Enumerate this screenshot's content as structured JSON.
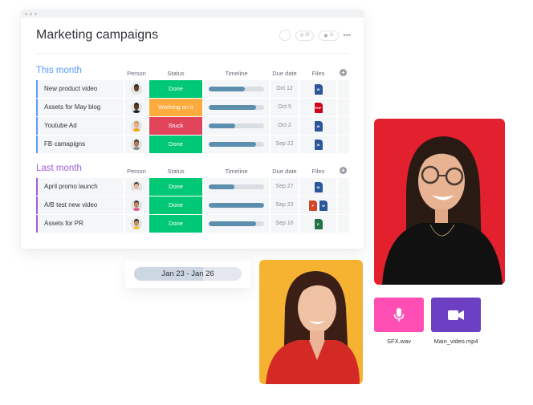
{
  "board": {
    "title": "Marketing campaigns",
    "header_tools": {
      "activity_count": "/0",
      "views_count": "/1",
      "more": "•••"
    }
  },
  "columns": {
    "person": "Person",
    "status": "Status",
    "timeline": "Timeline",
    "due_date": "Due date",
    "files": "Files",
    "add": "+"
  },
  "groups": [
    {
      "title": "This month",
      "accent_color": "#579bfc",
      "title_color": "#579bfc",
      "rows": [
        {
          "name": "New product video",
          "status": "Done",
          "status_color": "#00c875",
          "timeline_progress": 0.65,
          "due": "Oct 12",
          "files": [
            {
              "type": "W",
              "color": "#2b579a"
            }
          ],
          "avatar": {
            "skin": "#6b4226",
            "hair": "#1b1b1b",
            "shirt": "#e9e9e9"
          }
        },
        {
          "name": "Assets for May blog",
          "status": "Working on it",
          "status_color": "#fdab3d",
          "timeline_progress": 0.85,
          "due": "Oct 5",
          "files": [
            {
              "type": "PDF",
              "color": "#d0021b"
            }
          ],
          "avatar": {
            "skin": "#5b3a23",
            "hair": "#1b1b1b",
            "shirt": "#222222"
          }
        },
        {
          "name": "Youtube Ad",
          "status": "Stuck",
          "status_color": "#e2445c",
          "timeline_progress": 0.48,
          "due": "Oct 2",
          "files": [
            {
              "type": "W",
              "color": "#2b579a"
            }
          ],
          "avatar": {
            "skin": "#e8b48f",
            "hair": "#c98a3c",
            "shirt": "#f0a500"
          }
        },
        {
          "name": "FB camapigns",
          "status": "Done",
          "status_color": "#00c875",
          "timeline_progress": 0.85,
          "due": "Sep 22",
          "files": [
            {
              "type": "W",
              "color": "#2b579a"
            }
          ],
          "avatar": {
            "skin": "#b07a58",
            "hair": "#3a2a20",
            "shirt": "#8c8c8c"
          }
        }
      ]
    },
    {
      "title": "Last month",
      "accent_color": "#a25ddc",
      "title_color": "#a25ddc",
      "rows": [
        {
          "name": "April promo launch",
          "status": "Done",
          "status_color": "#00c875",
          "timeline_progress": 0.47,
          "due": "Sep 27",
          "files": [
            {
              "type": "W",
              "color": "#2b579a"
            }
          ],
          "avatar": {
            "skin": "#e7b898",
            "hair": "#3b2a1f",
            "shirt": "#f2f2f2"
          }
        },
        {
          "name": "A/B test new video",
          "status": "Done",
          "status_color": "#00c875",
          "timeline_progress": 1.0,
          "due": "Sep 22",
          "files": [
            {
              "type": "P",
              "color": "#d24726"
            },
            {
              "type": "W",
              "color": "#2b579a"
            }
          ],
          "avatar": {
            "skin": "#c08a66",
            "hair": "#3a2a20",
            "shirt": "#e05a8f"
          }
        },
        {
          "name": "Assets for PR",
          "status": "Done",
          "status_color": "#00c875",
          "timeline_progress": 0.85,
          "due": "Sep 16",
          "files": [
            {
              "type": "E",
              "color": "#217346"
            }
          ],
          "avatar": {
            "skin": "#c98d62",
            "hair": "#2a1d14",
            "shirt": "#f0c040"
          }
        }
      ]
    }
  ],
  "date_range": {
    "label": "Jan 23 - Jan 26",
    "progress": 0.64
  },
  "media": [
    {
      "name": "SFX.wav",
      "icon": "microphone-icon",
      "color": "#ff4fb4"
    },
    {
      "name": "Main_video.mp4",
      "icon": "video-camera-icon",
      "color": "#6c3fc3"
    }
  ],
  "photos": [
    {
      "subject": "smiling woman with glasses",
      "background": "#e3202e"
    },
    {
      "subject": "smiling woman in red shirt",
      "background": "#f6b332"
    }
  ]
}
